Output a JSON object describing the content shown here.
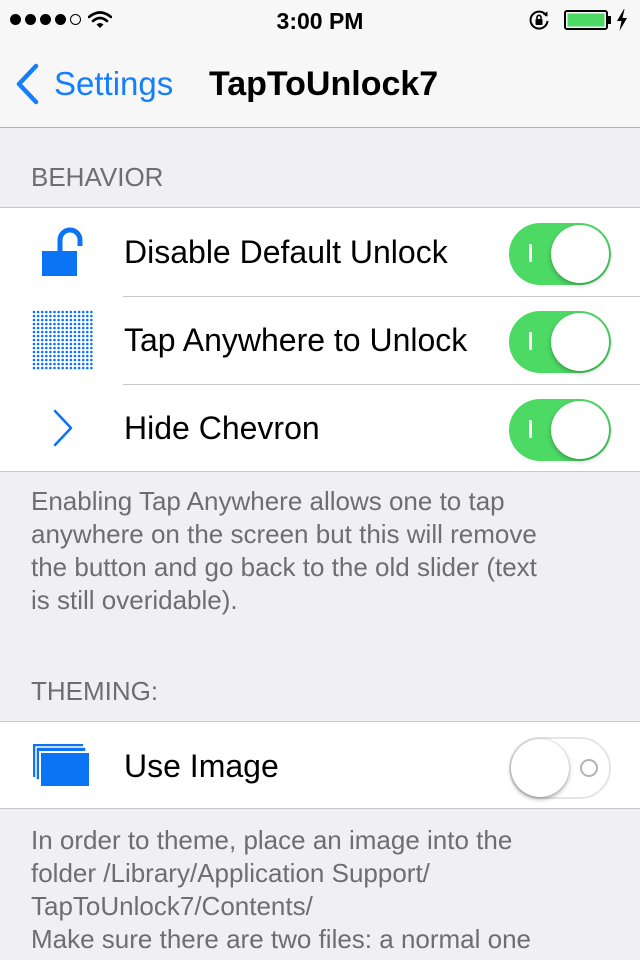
{
  "status_bar": {
    "time": "3:00 PM",
    "signal_bars_filled": 4,
    "signal_bars_total": 5,
    "icons": [
      "signal-dots-icon",
      "wifi-icon",
      "rotation-lock-icon",
      "battery-icon",
      "charging-bolt-icon"
    ],
    "battery_level": 1.0,
    "battery_color": "#4cd964"
  },
  "nav": {
    "back_label": "Settings",
    "title": "TapToUnlock7",
    "accent_color": "#157efb"
  },
  "behavior": {
    "header": "BEHAVIOR",
    "rows": [
      {
        "label": "Disable Default Unlock",
        "icon": "unlocked-padlock-icon",
        "on": true
      },
      {
        "label": "Tap Anywhere to Unlock",
        "icon": "dot-grid-icon",
        "on": true
      },
      {
        "label": "Hide Chevron",
        "icon": "chevron-right-icon",
        "on": true
      }
    ],
    "footer": [
      "Enabling Tap Anywhere allows one to tap",
      "anywhere on the screen but this will remove",
      "the button and go back to the old slider (text",
      "is still overidable)."
    ]
  },
  "theming": {
    "header": "THEMING:",
    "rows": [
      {
        "label": "Use Image",
        "icon": "stacked-images-icon",
        "on": false
      }
    ],
    "footer": [
      "In order to theme, place an image into the",
      "folder /Library/Application Support/",
      "TapToUnlock7/Contents/",
      "Make sure there are two files: a normal one"
    ]
  },
  "colors": {
    "switch_on": "#4cd964",
    "icon_blue": "#0a74f5",
    "background": "#efeff4"
  }
}
